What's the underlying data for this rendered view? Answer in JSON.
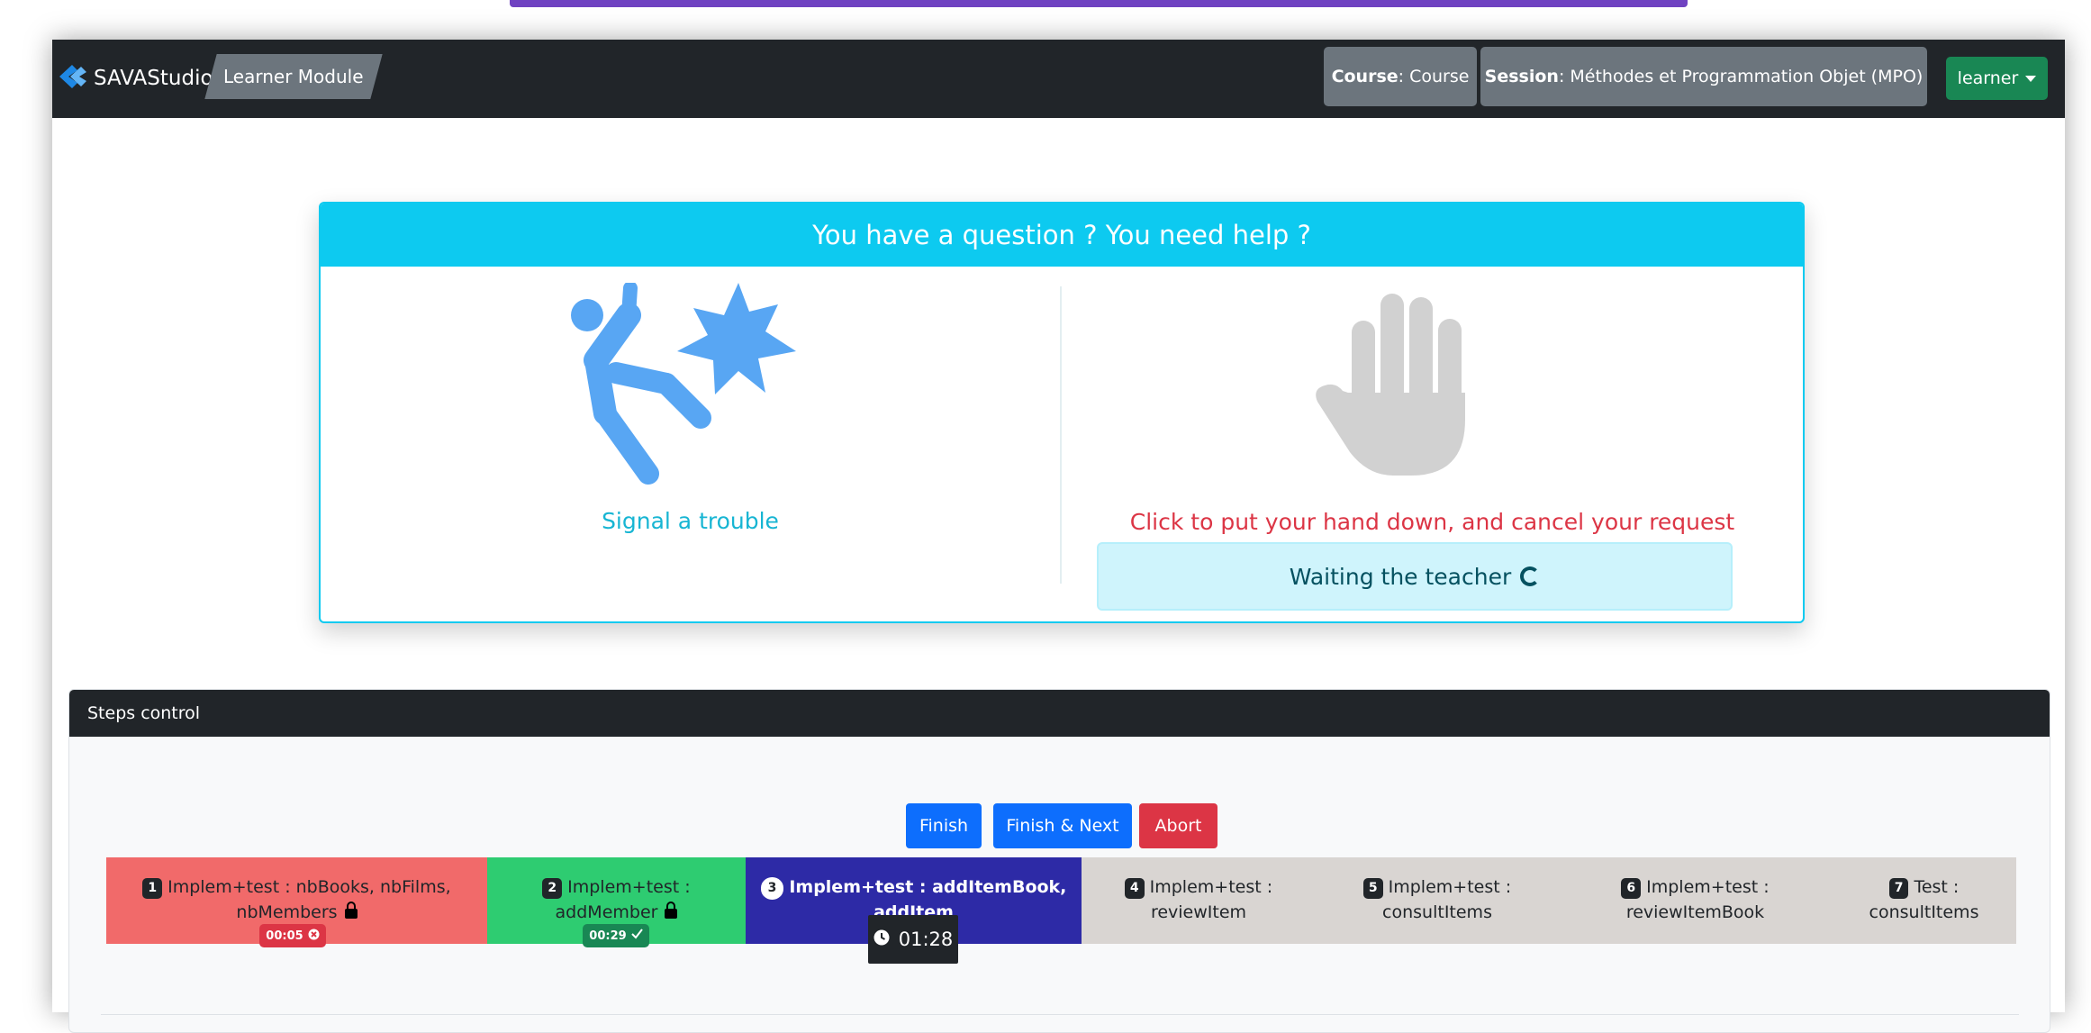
{
  "navbar": {
    "brand": "SAVAStudio",
    "module": "Learner Module",
    "course_label": "Course",
    "course_value": ": Course",
    "session_label": "Session",
    "session_value": ": Méthodes et Programmation Objet (MPO)",
    "user": "learner"
  },
  "help": {
    "title": "You have a question ? You need help ?",
    "trouble_label": "Signal a trouble",
    "cancel_label": "Click to put your hand down, and cancel your request",
    "waiting": "Waiting the teacher"
  },
  "steps": {
    "header": "Steps control",
    "buttons": {
      "finish": "Finish",
      "finish_next": "Finish & Next",
      "abort": "Abort"
    },
    "items": [
      {
        "num": "1",
        "label": "Implem+test : nbBooks, nbFilms, nbMembers",
        "state": "failed",
        "time": "00:05"
      },
      {
        "num": "2",
        "label": "Implem+test : addMember",
        "state": "done",
        "time": "00:29"
      },
      {
        "num": "3",
        "label": "Implem+test : addItemBook, addItem",
        "state": "active",
        "time": "01:28"
      },
      {
        "num": "4",
        "label": "Implem+test : reviewItem",
        "state": "pending"
      },
      {
        "num": "5",
        "label": "Implem+test : consultItems",
        "state": "pending"
      },
      {
        "num": "6",
        "label": "Implem+test : reviewItemBook",
        "state": "pending"
      },
      {
        "num": "7",
        "label": "Test : consultItems",
        "state": "pending"
      }
    ]
  },
  "icons": {
    "logo": "savastudio-logo-icon",
    "trouble": "person-slip-icon",
    "hand": "raised-hand-icon",
    "spinner": "spinner-icon",
    "lock": "lock-icon",
    "clock": "clock-icon"
  },
  "colors": {
    "navbar": "#212529",
    "info": "#0dcaf0",
    "danger": "#dc3545",
    "success": "#198754",
    "primary": "#0d6efd",
    "step_failed": "#f16a6a",
    "step_done": "#2ecc71",
    "step_active": "#2d2aa6",
    "step_pending": "#d9d5d2"
  }
}
